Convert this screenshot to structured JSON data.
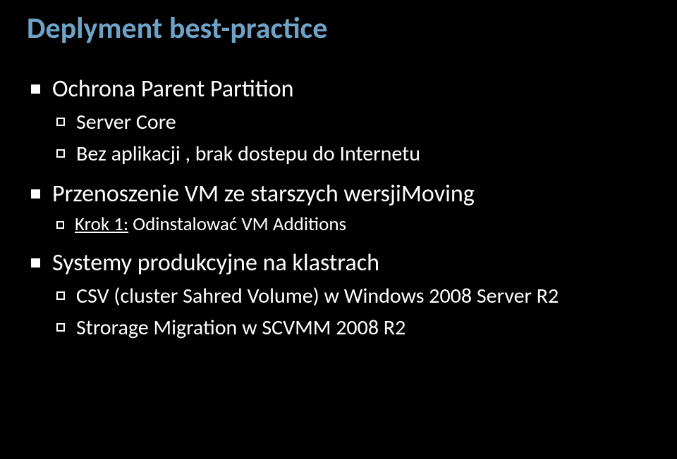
{
  "title": "Deplyment best-practice",
  "bullets": [
    {
      "text": "Ochrona Parent Partition",
      "children": [
        {
          "text": "Server Core"
        },
        {
          "text": "Bez aplikacji , brak dostepu do Internetu"
        }
      ]
    },
    {
      "text": "Przenoszenie VM ze starszych wersjiMoving",
      "children": [
        {
          "prefix": "Krok 1:",
          "rest": " Odinstalować VM Additions"
        }
      ]
    },
    {
      "text": "Systemy produkcyjne na klastrach",
      "children": [
        {
          "text": "CSV (cluster Sahred Volume) w Windows 2008 Server R2"
        },
        {
          "text": "Strorage Migration w SCVMM 2008 R2"
        }
      ]
    }
  ]
}
